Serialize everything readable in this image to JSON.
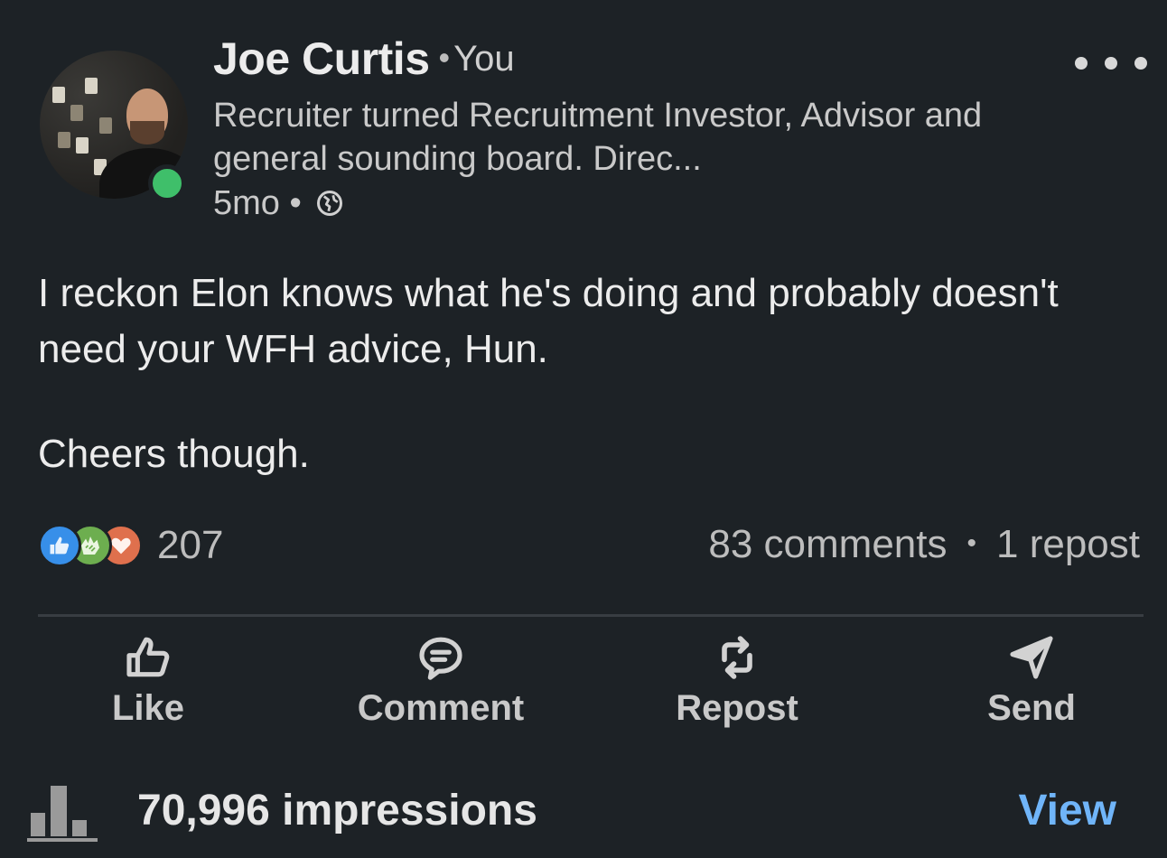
{
  "author": {
    "name": "Joe Curtis",
    "relation": "You",
    "headline": "Recruiter turned Recruitment Investor, Advisor and general sounding board. Direc...",
    "time": "5mo",
    "visibility_icon": "globe-icon",
    "presence": "online"
  },
  "post": {
    "paragraphs": [
      "I reckon Elon knows what he's doing and probably doesn't need your WFH advice, Hun.",
      "Cheers though."
    ]
  },
  "social": {
    "reaction_icons": [
      "like-reaction-icon",
      "celebrate-reaction-icon",
      "love-reaction-icon"
    ],
    "reactions_count": "207",
    "comments": "83 comments",
    "reposts": "1 repost"
  },
  "actions": {
    "like": "Like",
    "comment": "Comment",
    "repost": "Repost",
    "send": "Send"
  },
  "analytics": {
    "impressions": "70,996 impressions",
    "view_label": "View"
  },
  "colors": {
    "background": "#1d2226",
    "link": "#70b5f9",
    "presence": "#3fbf6a"
  }
}
